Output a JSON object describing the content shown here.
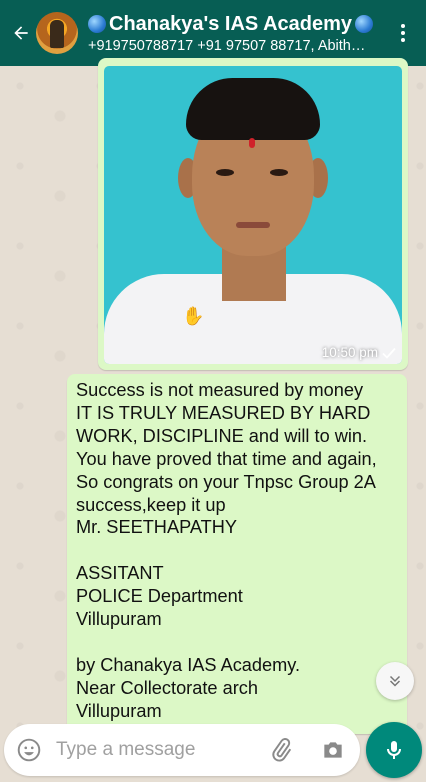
{
  "header": {
    "title": "Chanakya's IAS Academy",
    "subtitle": "+919750788717 +91 97507 88717, Abith…"
  },
  "messages": [
    {
      "type": "image",
      "time": "10:50 pm"
    },
    {
      "type": "text",
      "lines": [
        "Success is not measured by money",
        "IT IS TRULY MEASURED BY HARD",
        "WORK, DISCIPLINE and will to win.",
        "You have proved that time and again,",
        "So congrats on your Tnpsc Group 2A",
        "success,keep it up",
        "Mr. SEETHAPATHY",
        "",
        "ASSITANT",
        "POLICE Department",
        "Villupuram",
        "",
        "by Chanakya IAS Academy.",
        "Near Collectorate arch",
        "Villupuram"
      ]
    }
  ],
  "input": {
    "placeholder": "Type a message"
  },
  "icons": {
    "back": "arrow-back-icon",
    "menu": "more-vert-icon",
    "emoji": "emoji-icon",
    "attach": "paperclip-icon",
    "camera": "camera-icon",
    "mic": "mic-icon",
    "scroll": "chevron-double-down-icon",
    "read": "check-icon"
  },
  "colors": {
    "header": "#075e54",
    "bubble_out": "#dcf8c6",
    "fab": "#00897b"
  }
}
